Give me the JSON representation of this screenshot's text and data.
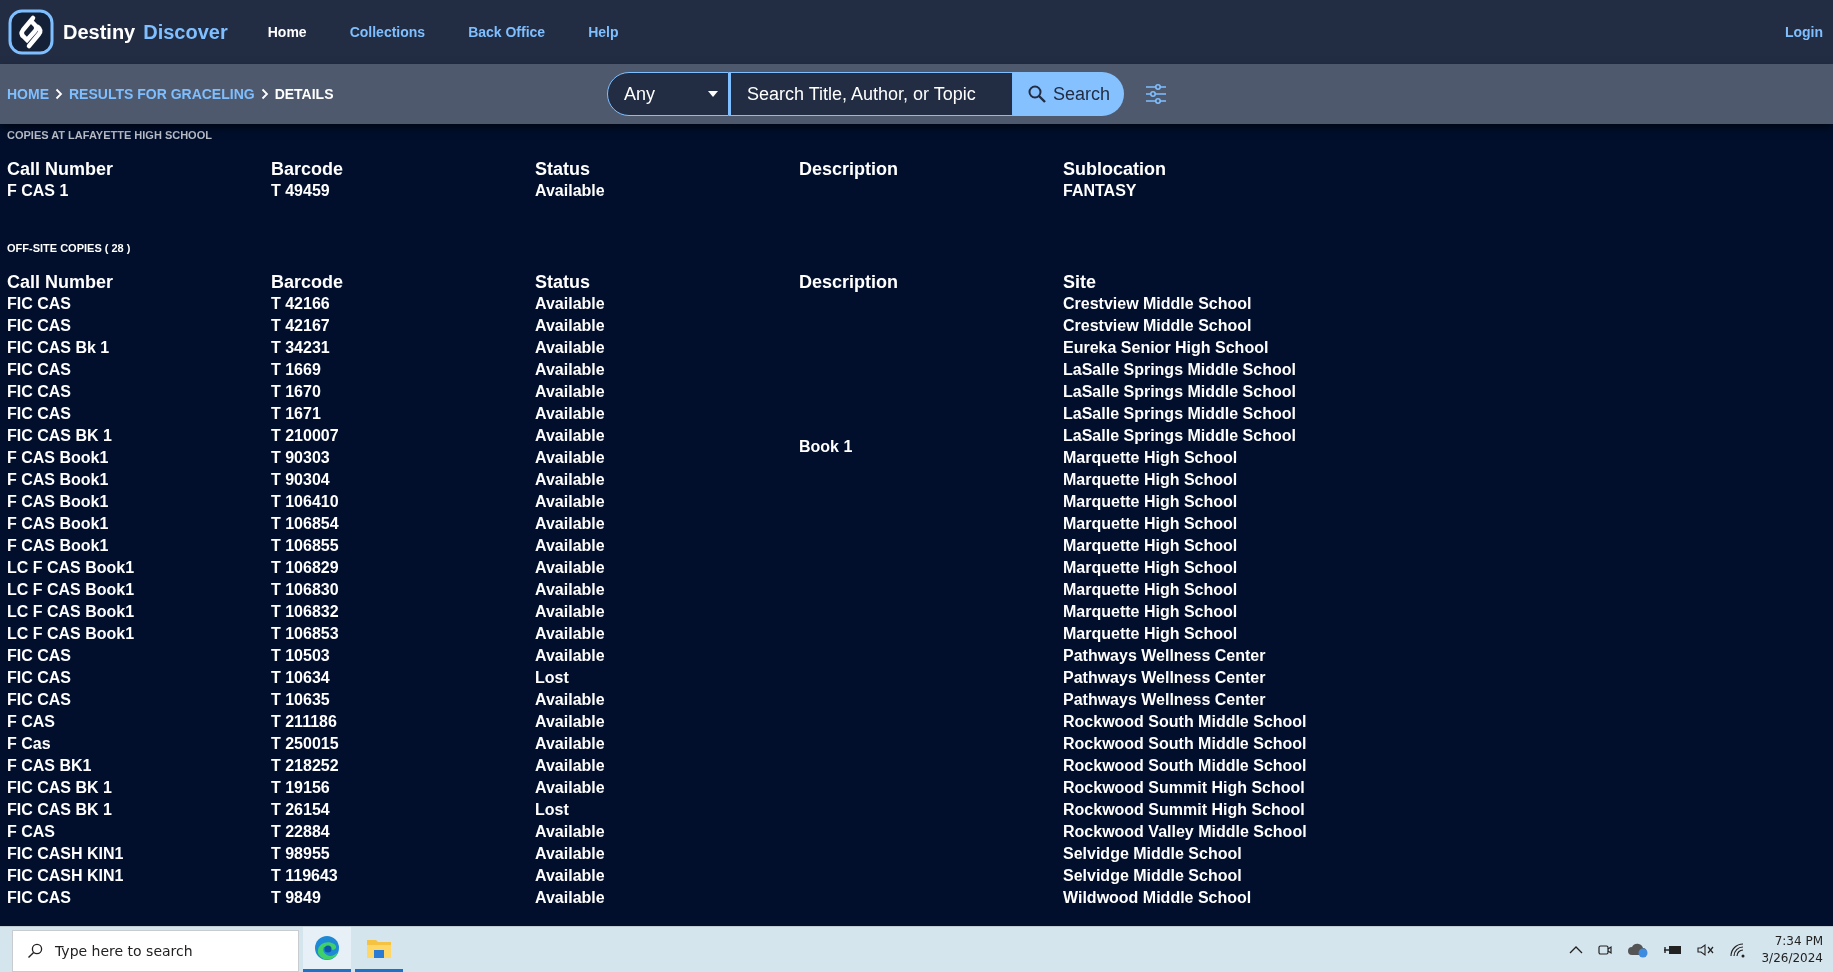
{
  "header": {
    "brand": "Destiny",
    "brand_accent": "Discover",
    "nav": [
      {
        "label": "Home",
        "selected": true
      },
      {
        "label": "Collections",
        "selected": false
      },
      {
        "label": "Back Office",
        "selected": false
      },
      {
        "label": "Help",
        "selected": false
      }
    ],
    "login": "Login"
  },
  "breadcrumb": [
    {
      "label": "HOME",
      "kind": "link"
    },
    {
      "label": "RESULTS FOR GRACELING",
      "kind": "link"
    },
    {
      "label": "DETAILS",
      "kind": "current"
    }
  ],
  "search": {
    "scope": "Any",
    "placeholder": "Search Title, Author, or Topic",
    "button": "Search"
  },
  "local_copies": {
    "title": "COPIES AT LAFAYETTE HIGH SCHOOL",
    "columns": [
      "Call Number",
      "Barcode",
      "Status",
      "Description",
      "Sublocation"
    ],
    "rows": [
      {
        "call_number": "F CAS 1",
        "barcode": "T 49459",
        "status": "Available",
        "description": "",
        "place": "FANTASY"
      }
    ]
  },
  "offsite_copies": {
    "title": "OFF-SITE COPIES ( 28 )",
    "columns": [
      "Call Number",
      "Barcode",
      "Status",
      "Description",
      "Site"
    ],
    "rows": [
      {
        "call_number": "FIC CAS",
        "barcode": "T 42166",
        "status": "Available",
        "description": "",
        "place": "Crestview Middle School"
      },
      {
        "call_number": "FIC CAS",
        "barcode": "T 42167",
        "status": "Available",
        "description": "",
        "place": "Crestview Middle School"
      },
      {
        "call_number": "FIC CAS Bk 1",
        "barcode": "T 34231",
        "status": "Available",
        "description": "",
        "place": "Eureka Senior High School"
      },
      {
        "call_number": "FIC CAS",
        "barcode": "T 1669",
        "status": "Available",
        "description": "",
        "place": "LaSalle Springs Middle School"
      },
      {
        "call_number": "FIC CAS",
        "barcode": "T 1670",
        "status": "Available",
        "description": "",
        "place": "LaSalle Springs Middle School"
      },
      {
        "call_number": "FIC CAS",
        "barcode": "T 1671",
        "status": "Available",
        "description": "",
        "place": "LaSalle Springs Middle School"
      },
      {
        "call_number": "FIC CAS BK 1",
        "barcode": "T 210007",
        "status": "Available",
        "description": "Book 1",
        "place": "LaSalle Springs Middle School"
      },
      {
        "call_number": "F CAS Book1",
        "barcode": "T 90303",
        "status": "Available",
        "description": "",
        "place": "Marquette High School"
      },
      {
        "call_number": "F CAS Book1",
        "barcode": "T 90304",
        "status": "Available",
        "description": "",
        "place": "Marquette High School"
      },
      {
        "call_number": "F CAS Book1",
        "barcode": "T 106410",
        "status": "Available",
        "description": "",
        "place": "Marquette High School"
      },
      {
        "call_number": "F CAS Book1",
        "barcode": "T 106854",
        "status": "Available",
        "description": "",
        "place": "Marquette High School"
      },
      {
        "call_number": "F CAS Book1",
        "barcode": "T 106855",
        "status": "Available",
        "description": "",
        "place": "Marquette High School"
      },
      {
        "call_number": "LC F CAS Book1",
        "barcode": "T 106829",
        "status": "Available",
        "description": "",
        "place": "Marquette High School"
      },
      {
        "call_number": "LC F CAS Book1",
        "barcode": "T 106830",
        "status": "Available",
        "description": "",
        "place": "Marquette High School"
      },
      {
        "call_number": "LC F CAS Book1",
        "barcode": "T 106832",
        "status": "Available",
        "description": "",
        "place": "Marquette High School"
      },
      {
        "call_number": "LC F CAS Book1",
        "barcode": "T 106853",
        "status": "Available",
        "description": "",
        "place": "Marquette High School"
      },
      {
        "call_number": "FIC CAS",
        "barcode": "T 10503",
        "status": "Available",
        "description": "",
        "place": "Pathways Wellness Center"
      },
      {
        "call_number": "FIC CAS",
        "barcode": "T 10634",
        "status": "Lost",
        "description": "",
        "place": "Pathways Wellness Center"
      },
      {
        "call_number": "FIC CAS",
        "barcode": "T 10635",
        "status": "Available",
        "description": "",
        "place": "Pathways Wellness Center"
      },
      {
        "call_number": "F CAS",
        "barcode": "T 211186",
        "status": "Available",
        "description": "",
        "place": "Rockwood South Middle School"
      },
      {
        "call_number": "F Cas",
        "barcode": "T 250015",
        "status": "Available",
        "description": "",
        "place": "Rockwood South Middle School"
      },
      {
        "call_number": "F CAS BK1",
        "barcode": "T 218252",
        "status": "Available",
        "description": "",
        "place": "Rockwood South Middle School"
      },
      {
        "call_number": "FIC CAS BK 1",
        "barcode": "T 19156",
        "status": "Available",
        "description": "",
        "place": "Rockwood Summit High School"
      },
      {
        "call_number": "FIC CAS BK 1",
        "barcode": "T 26154",
        "status": "Lost",
        "description": "",
        "place": "Rockwood Summit High School"
      },
      {
        "call_number": "F CAS",
        "barcode": "T 22884",
        "status": "Available",
        "description": "",
        "place": "Rockwood Valley Middle School"
      },
      {
        "call_number": "FIC CASH KIN1",
        "barcode": "T 98955",
        "status": "Available",
        "description": "",
        "place": "Selvidge Middle School"
      },
      {
        "call_number": "FIC CASH KIN1",
        "barcode": "T 119643",
        "status": "Available",
        "description": "",
        "place": "Selvidge Middle School"
      },
      {
        "call_number": "FIC CAS",
        "barcode": "T 9849",
        "status": "Available",
        "description": "",
        "place": "Wildwood Middle School"
      }
    ]
  },
  "taskbar": {
    "search_placeholder": "Type here to search",
    "time": "7:34 PM",
    "date": "3/26/2024"
  }
}
